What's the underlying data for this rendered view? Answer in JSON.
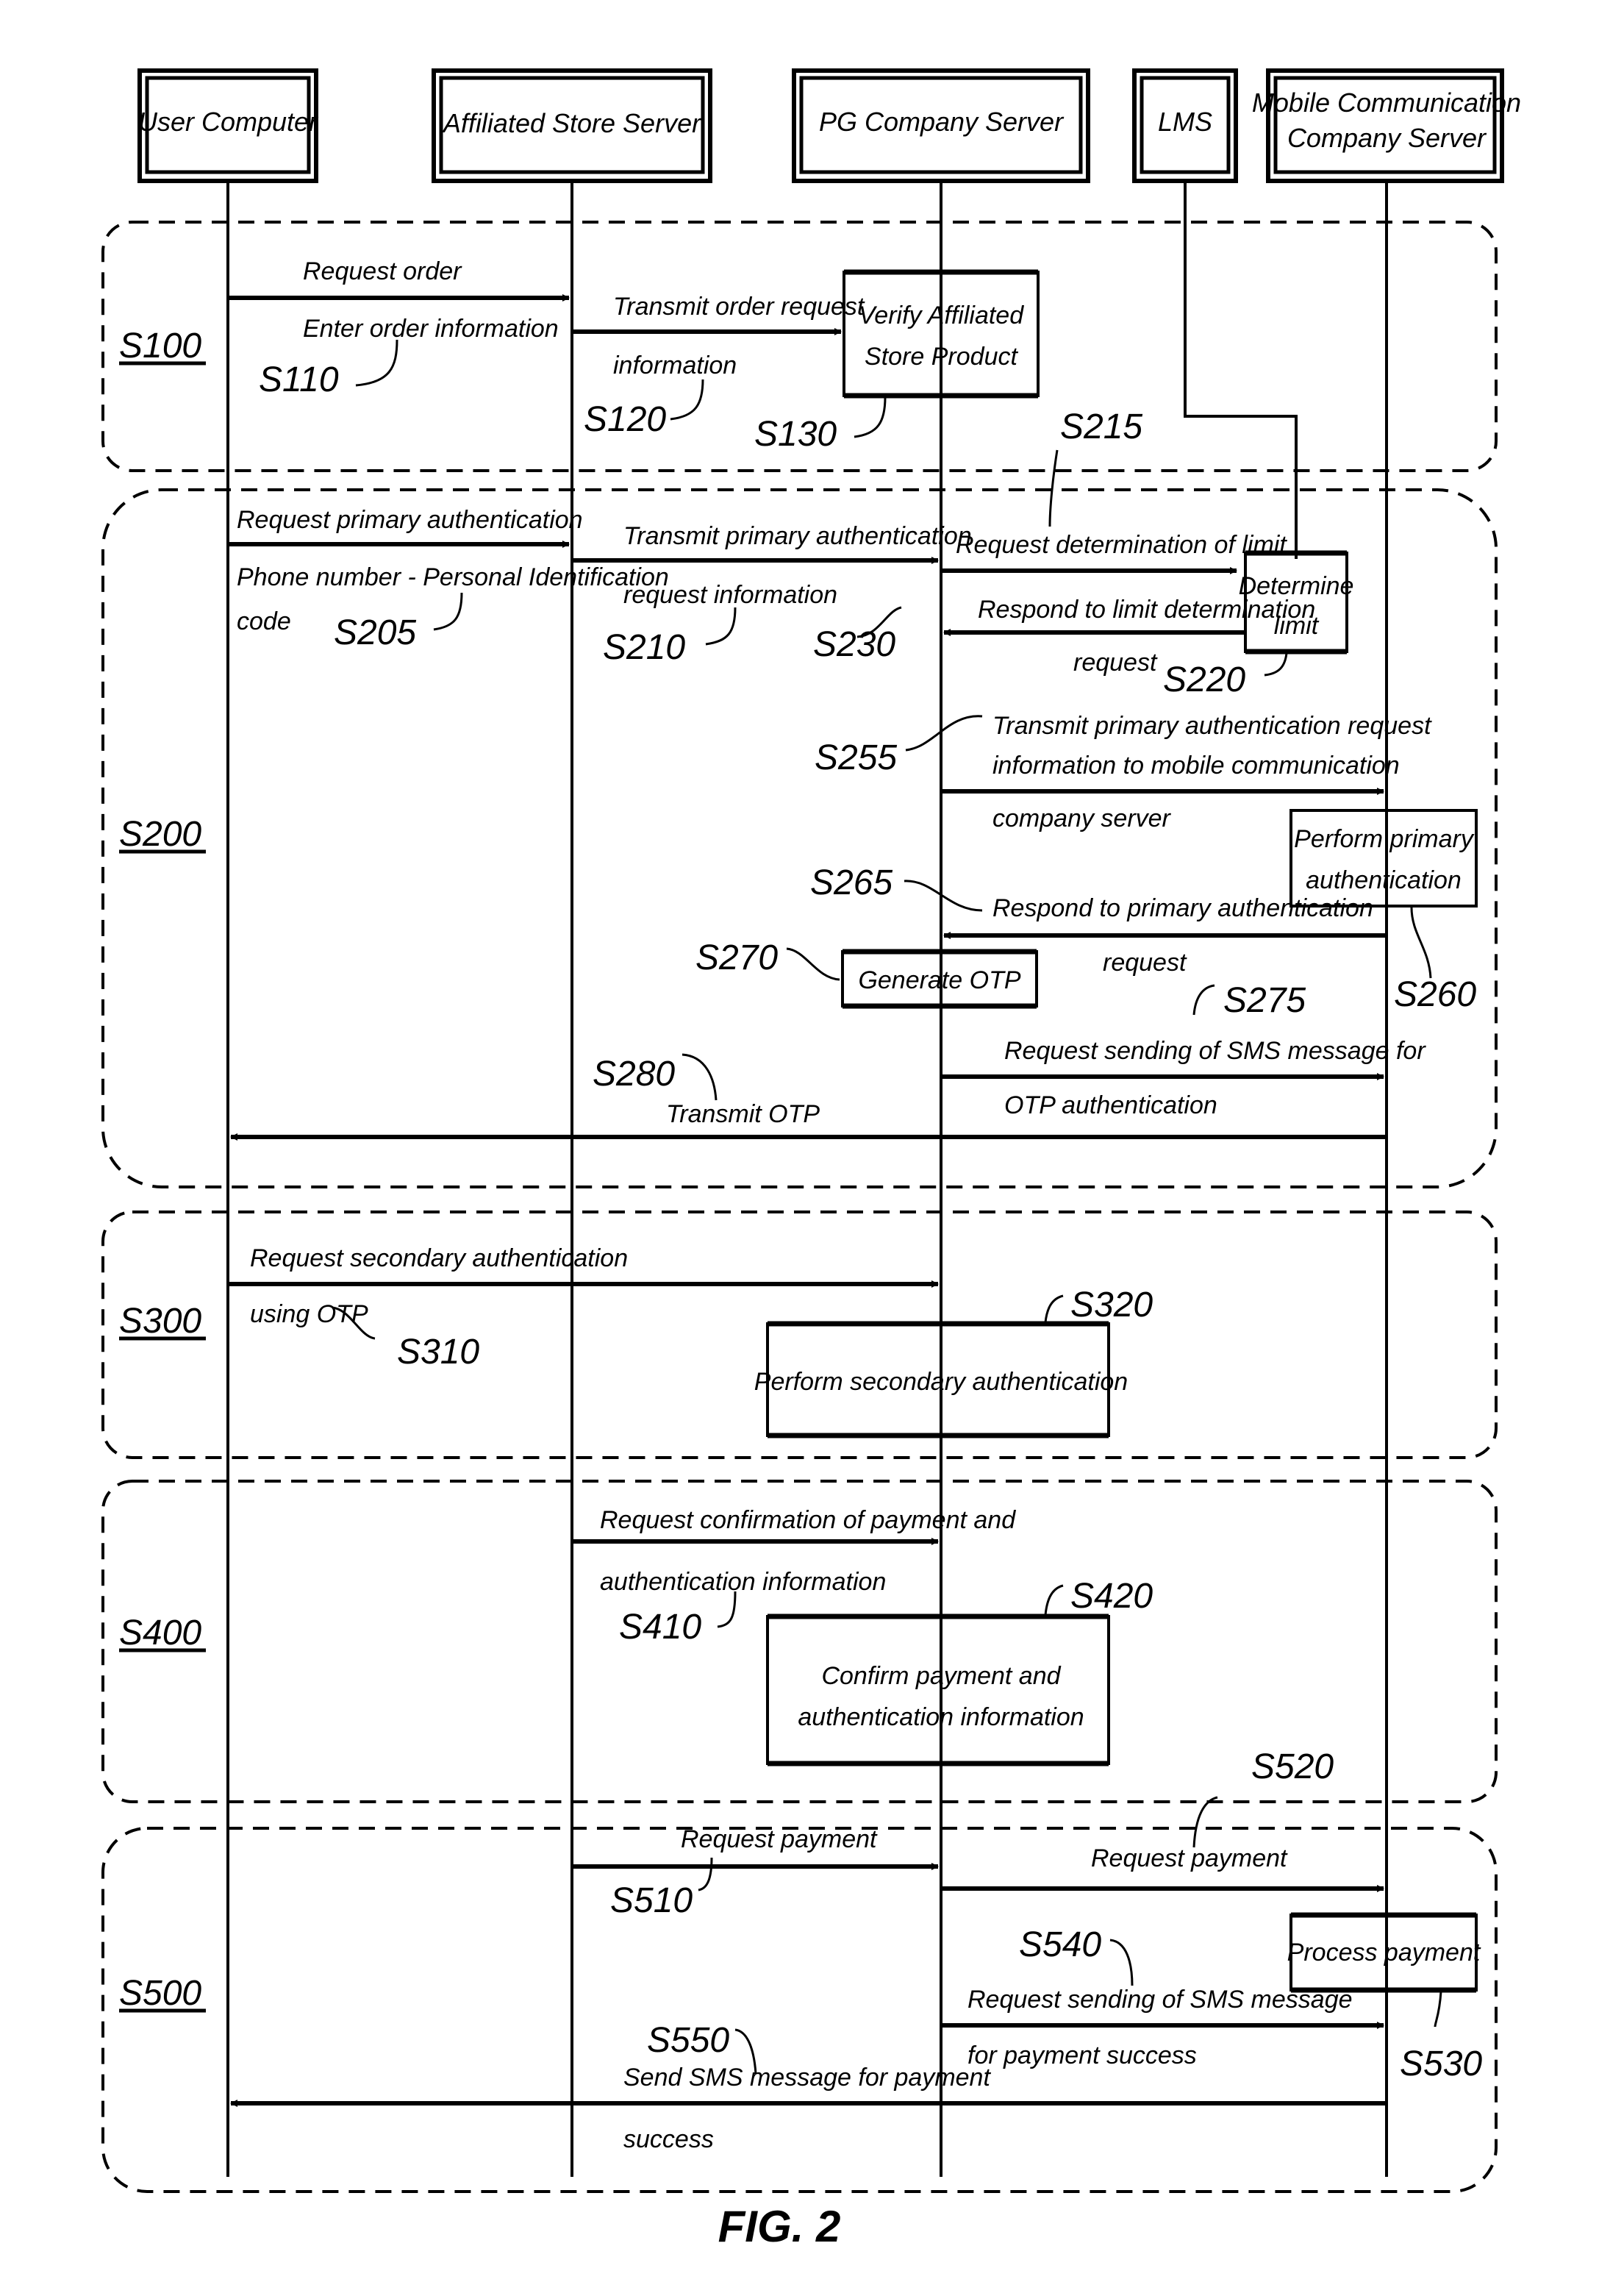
{
  "figure_label": "FIG. 2",
  "colors": {
    "ink": "#000000",
    "background": "#ffffff"
  },
  "actors": [
    {
      "id": "user",
      "label": "User Computer"
    },
    {
      "id": "store",
      "label": "Affiliated Store Server"
    },
    {
      "id": "pg",
      "label": "PG Company Server"
    },
    {
      "id": "lms",
      "label": "LMS"
    },
    {
      "id": "mobile",
      "label_line1": "Mobile Communication",
      "label_line2": "Company Server"
    }
  ],
  "sections": [
    {
      "id": "S100",
      "label": "S100"
    },
    {
      "id": "S200",
      "label": "S200"
    },
    {
      "id": "S300",
      "label": "S300"
    },
    {
      "id": "S400",
      "label": "S400"
    },
    {
      "id": "S500",
      "label": "S500"
    }
  ],
  "messages": {
    "s110": {
      "ref": "S110",
      "from": "user",
      "to": "store",
      "above": "Request order",
      "below": "Enter order information"
    },
    "s120": {
      "ref": "S120",
      "from": "store",
      "to": "pg",
      "above": "Transmit order request",
      "below": "information"
    },
    "s205": {
      "ref": "S205",
      "from": "user",
      "to": "store",
      "above": "Request primary authentication",
      "below": "Phone number - Personal Identification",
      "below2": "code"
    },
    "s210": {
      "ref": "S210",
      "from": "store",
      "to": "pg",
      "above": "Transmit primary authentication",
      "below": "request information"
    },
    "s215": {
      "ref": "S215",
      "from": "pg",
      "to": "lms",
      "above": "Request determination of limit"
    },
    "s230": {
      "ref": "S230",
      "from": "lms",
      "to": "pg",
      "above": "Respond to limit determination",
      "below": "request"
    },
    "s255": {
      "ref": "S255",
      "from": "pg",
      "to": "mobile",
      "above": "Transmit primary authentication request",
      "above2": "information to mobile communication",
      "below": "company server"
    },
    "s265": {
      "ref": "S265",
      "from": "mobile",
      "to": "pg",
      "above": "Respond to primary authentication",
      "below": "request"
    },
    "s275": {
      "ref": "S275",
      "from": "pg",
      "to": "mobile",
      "above": "Request sending of SMS message for",
      "below": "OTP authentication"
    },
    "s280": {
      "ref": "S280",
      "from": "mobile",
      "to": "user",
      "above": "Transmit OTP"
    },
    "s310": {
      "ref": "S310",
      "from": "user",
      "to": "pg",
      "above": "Request secondary authentication",
      "below": "using OTP"
    },
    "s410": {
      "ref": "S410",
      "from": "store",
      "to": "pg",
      "above": "Request confirmation of payment and",
      "below": "authentication information"
    },
    "s510": {
      "ref": "S510",
      "from": "store",
      "to": "pg",
      "above": "Request payment"
    },
    "s520": {
      "ref": "S520",
      "from": "pg",
      "to": "mobile",
      "above": "Request payment"
    },
    "s540": {
      "ref": "S540",
      "from": "pg",
      "to": "mobile",
      "above": "Request sending of SMS message",
      "below": "for payment success"
    },
    "s550": {
      "ref": "S550",
      "from": "mobile",
      "to": "user",
      "above": "Send SMS message for payment",
      "below": "success"
    }
  },
  "processes": {
    "s130": {
      "ref": "S130",
      "actor": "pg",
      "line1": "Verify Affiliated",
      "line2": "Store Product"
    },
    "s220": {
      "ref": "S220",
      "actor": "lms",
      "line1": "Determine",
      "line2": "limit"
    },
    "s260": {
      "ref": "S260",
      "actor": "mobile",
      "line1": "Perform primary",
      "line2": "authentication"
    },
    "s270": {
      "ref": "S270",
      "actor": "pg",
      "line1": "Generate OTP"
    },
    "s320": {
      "ref": "S320",
      "actor": "pg",
      "line1": "Perform secondary authentication"
    },
    "s420": {
      "ref": "S420",
      "actor": "pg",
      "line1": "Confirm payment and",
      "line2": "authentication information"
    },
    "s530": {
      "ref": "S530",
      "actor": "mobile",
      "line1": "Process payment"
    }
  }
}
